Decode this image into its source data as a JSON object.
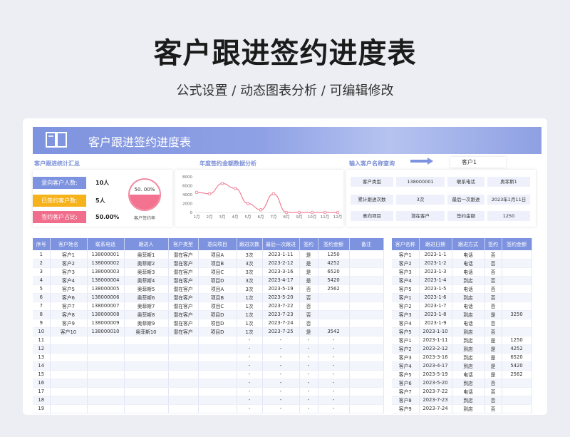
{
  "hero": {
    "title": "客户跟进签约进度表",
    "subtitle": "公式设置 / 动态图表分析 / 可编辑修改"
  },
  "banner": {
    "title": "客户跟进签约进度表"
  },
  "sections": {
    "stats": "客户跟进统计汇总",
    "chart": "年度签约金额数据分析",
    "query": "输入客户名称查询"
  },
  "query_input": "客户1",
  "stats": [
    {
      "label": "意向客户人数:",
      "value": "10人",
      "color": "#7e93df"
    },
    {
      "label": "已签约客户数:",
      "value": "5人",
      "color": "#f6b21b"
    },
    {
      "label": "签约客户占比:",
      "value": "50.00%",
      "color": "#f06e8c"
    }
  ],
  "gauge": {
    "value": "50. 00%",
    "caption": "客户签约率",
    "fraction": 0.5
  },
  "query": {
    "rows": [
      [
        "客户类型",
        "138000001",
        "联系电话",
        "奥菲斯1"
      ],
      [
        "累计跟进次数",
        "3次",
        "最后一次跟进",
        "2023年1月11日"
      ],
      [
        "意向项目",
        "潜在客户",
        "签约金额",
        "1250"
      ]
    ]
  },
  "chart_data": {
    "type": "line",
    "categories": [
      "1月",
      "2月",
      "3月",
      "4月",
      "5月",
      "6月",
      "7月",
      "8月",
      "9月",
      "10月",
      "11月",
      "12月"
    ],
    "values": [
      4500,
      4200,
      6500,
      5400,
      2000,
      600,
      4200,
      0,
      0,
      0,
      0,
      0
    ],
    "yticks": [
      "8000",
      "6000",
      "4000",
      "2000",
      "0"
    ],
    "ylim": [
      0,
      8000
    ],
    "color": "#f07f96"
  },
  "table_main": {
    "headers": [
      "序号",
      "客户姓名",
      "联系电话",
      "跟进人",
      "客户类型",
      "意向项目",
      "跟进次数",
      "最后一次跟进",
      "签约",
      "签约金额",
      "备注"
    ],
    "rows": [
      [
        "1",
        "客户1",
        "138000001",
        "奥菲斯1",
        "潜在客户",
        "项目A",
        "3次",
        "2023-1-11",
        "是",
        "1250",
        ""
      ],
      [
        "2",
        "客户2",
        "138000002",
        "奥菲斯2",
        "潜在客户",
        "项目B",
        "3次",
        "2023-2-12",
        "是",
        "4252",
        ""
      ],
      [
        "3",
        "客户3",
        "138000003",
        "奥菲斯3",
        "潜在客户",
        "项目C",
        "3次",
        "2023-3-16",
        "是",
        "6520",
        ""
      ],
      [
        "4",
        "客户4",
        "138000004",
        "奥菲斯4",
        "潜在客户",
        "项目D",
        "3次",
        "2023-4-17",
        "是",
        "5420",
        ""
      ],
      [
        "5",
        "客户5",
        "138000005",
        "奥菲斯5",
        "潜在客户",
        "项目A",
        "3次",
        "2023-5-19",
        "否",
        "2562",
        ""
      ],
      [
        "6",
        "客户6",
        "138000006",
        "奥菲斯6",
        "潜在客户",
        "项目B",
        "1次",
        "2023-5-20",
        "否",
        "",
        ""
      ],
      [
        "7",
        "客户7",
        "138000007",
        "奥菲斯7",
        "潜在客户",
        "项目C",
        "1次",
        "2023-7-22",
        "否",
        "",
        ""
      ],
      [
        "8",
        "客户8",
        "138000008",
        "奥菲斯8",
        "潜在客户",
        "项目D",
        "1次",
        "2023-7-23",
        "否",
        "",
        ""
      ],
      [
        "9",
        "客户9",
        "138000009",
        "奥菲斯9",
        "潜在客户",
        "项目D",
        "1次",
        "2023-7-24",
        "否",
        "",
        ""
      ],
      [
        "10",
        "客户10",
        "138000010",
        "奥菲斯10",
        "潜在客户",
        "项目D",
        "1次",
        "2023-7-25",
        "是",
        "3542",
        ""
      ],
      [
        "11",
        "",
        "",
        "",
        "",
        "",
        "-",
        "-",
        "-",
        "-",
        ""
      ],
      [
        "12",
        "",
        "",
        "",
        "",
        "",
        "-",
        "-",
        "-",
        "-",
        ""
      ],
      [
        "13",
        "",
        "",
        "",
        "",
        "",
        "-",
        "-",
        "-",
        "-",
        ""
      ],
      [
        "14",
        "",
        "",
        "",
        "",
        "",
        "-",
        "-",
        "-",
        "-",
        ""
      ],
      [
        "15",
        "",
        "",
        "",
        "",
        "",
        "-",
        "-",
        "-",
        "-",
        ""
      ],
      [
        "16",
        "",
        "",
        "",
        "",
        "",
        "-",
        "-",
        "-",
        "-",
        ""
      ],
      [
        "17",
        "",
        "",
        "",
        "",
        "",
        "-",
        "-",
        "-",
        "-",
        ""
      ],
      [
        "18",
        "",
        "",
        "",
        "",
        "",
        "-",
        "-",
        "-",
        "-",
        ""
      ],
      [
        "19",
        "",
        "",
        "",
        "",
        "",
        "-",
        "-",
        "-",
        "-",
        ""
      ]
    ]
  },
  "table_side": {
    "headers": [
      "客户名称",
      "跟进日期",
      "跟进方式",
      "签约",
      "签约金额"
    ],
    "rows": [
      [
        "客户1",
        "2023-1-1",
        "电话",
        "否",
        ""
      ],
      [
        "客户2",
        "2023-1-2",
        "电话",
        "否",
        ""
      ],
      [
        "客户3",
        "2023-1-3",
        "电话",
        "否",
        ""
      ],
      [
        "客户4",
        "2023-1-4",
        "到店",
        "否",
        ""
      ],
      [
        "客户5",
        "2023-1-5",
        "电话",
        "否",
        ""
      ],
      [
        "客户1",
        "2023-1-6",
        "到店",
        "否",
        ""
      ],
      [
        "客户2",
        "2023-1-7",
        "电话",
        "否",
        ""
      ],
      [
        "客户3",
        "2023-1-8",
        "到店",
        "是",
        "3250"
      ],
      [
        "客户4",
        "2023-1-9",
        "电话",
        "否",
        ""
      ],
      [
        "客户5",
        "2023-1-10",
        "到店",
        "否",
        ""
      ],
      [
        "客户1",
        "2023-1-11",
        "到店",
        "是",
        "1250"
      ],
      [
        "客户2",
        "2023-2-12",
        "到店",
        "是",
        "4252"
      ],
      [
        "客户3",
        "2023-3-16",
        "到店",
        "是",
        "6520"
      ],
      [
        "客户4",
        "2023-4-17",
        "到店",
        "是",
        "5420"
      ],
      [
        "客户5",
        "2023-5-19",
        "电话",
        "是",
        "2562"
      ],
      [
        "客户6",
        "2023-5-20",
        "到店",
        "否",
        ""
      ],
      [
        "客户7",
        "2023-7-22",
        "电话",
        "否",
        ""
      ],
      [
        "客户8",
        "2023-7-23",
        "到店",
        "否",
        ""
      ],
      [
        "客户9",
        "2023-7-24",
        "到店",
        "否",
        ""
      ]
    ]
  }
}
